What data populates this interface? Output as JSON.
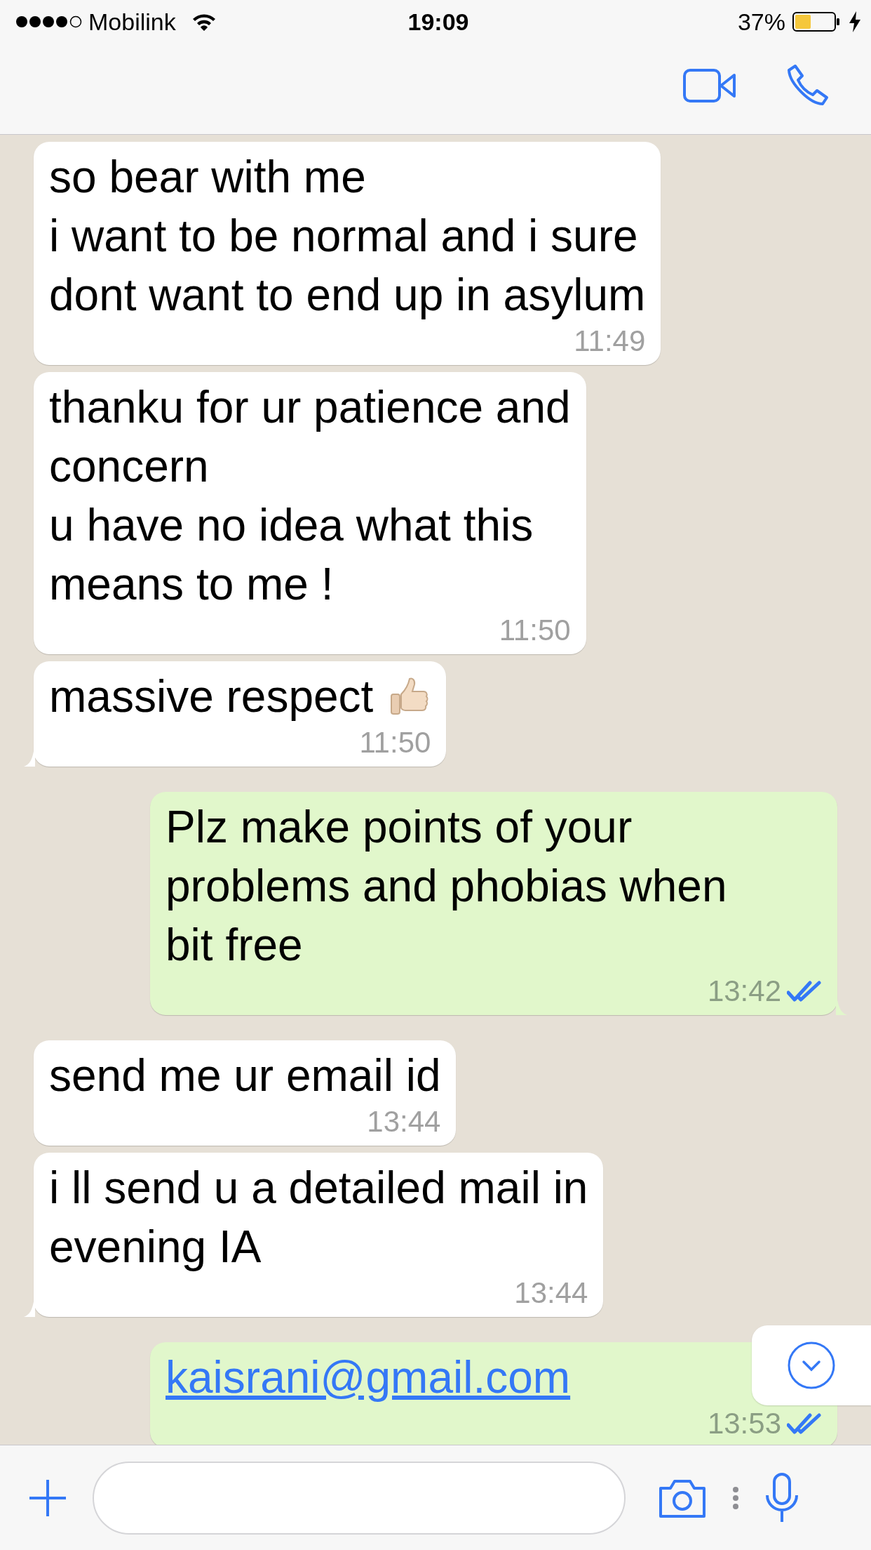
{
  "status_bar": {
    "carrier": "Mobilink",
    "time": "19:09",
    "battery": "37%"
  },
  "messages": [
    {
      "kind": "text",
      "outgoing": false,
      "text": "so bear with me\ni want to be normal and i sure\ndont want to end up in asylum",
      "time": "11:49",
      "tail": false
    },
    {
      "kind": "text",
      "outgoing": false,
      "text": "thanku for ur patience and\nconcern\nu have no idea what this\nmeans to me !",
      "time": "11:50",
      "tail": false
    },
    {
      "kind": "text",
      "outgoing": false,
      "text": "massive respect",
      "thumbs_up": true,
      "time": "11:50",
      "tail": true
    },
    {
      "kind": "text",
      "outgoing": true,
      "text": "Plz make points of your\nproblems and phobias when\nbit free",
      "time": "13:42",
      "read": true,
      "tail": true
    },
    {
      "kind": "text",
      "outgoing": false,
      "text": "send me ur email id",
      "time": "13:44",
      "tail": false
    },
    {
      "kind": "text",
      "outgoing": false,
      "text": "i ll send u a detailed mail in\nevening IA",
      "time": "13:44",
      "tail": true
    },
    {
      "kind": "link",
      "outgoing": true,
      "text": "kaisrani@gmail.com",
      "time": "13:53",
      "read": true,
      "tail": false
    }
  ]
}
